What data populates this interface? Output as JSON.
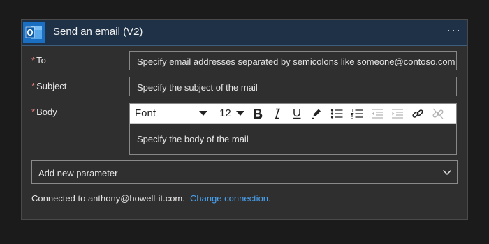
{
  "header": {
    "title": "Send an email (V2)",
    "app_icon": "outlook-icon",
    "more_label": "···",
    "accent": "#1a6fc2",
    "bar_color": "#1f3147"
  },
  "fields": {
    "required_mark": "*",
    "to": {
      "label": "To",
      "placeholder": "Specify email addresses separated by semicolons like someone@contoso.com"
    },
    "subject": {
      "label": "Subject",
      "placeholder": "Specify the subject of the mail"
    },
    "body": {
      "label": "Body",
      "placeholder": "Specify the body of the mail"
    }
  },
  "toolbar": {
    "font": "Font",
    "size": "12",
    "buttons": [
      "bold-icon",
      "italic-icon",
      "underline-icon",
      "text-color-icon",
      "bullet-list-icon",
      "numbered-list-icon",
      "decrease-indent-icon",
      "increase-indent-icon",
      "insert-link-icon",
      "remove-link-icon"
    ]
  },
  "add_parameter": {
    "label": "Add new parameter"
  },
  "connection": {
    "text": "Connected to anthony@howell-it.com.",
    "link": "Change connection.",
    "link_color": "#4aa3f2"
  }
}
